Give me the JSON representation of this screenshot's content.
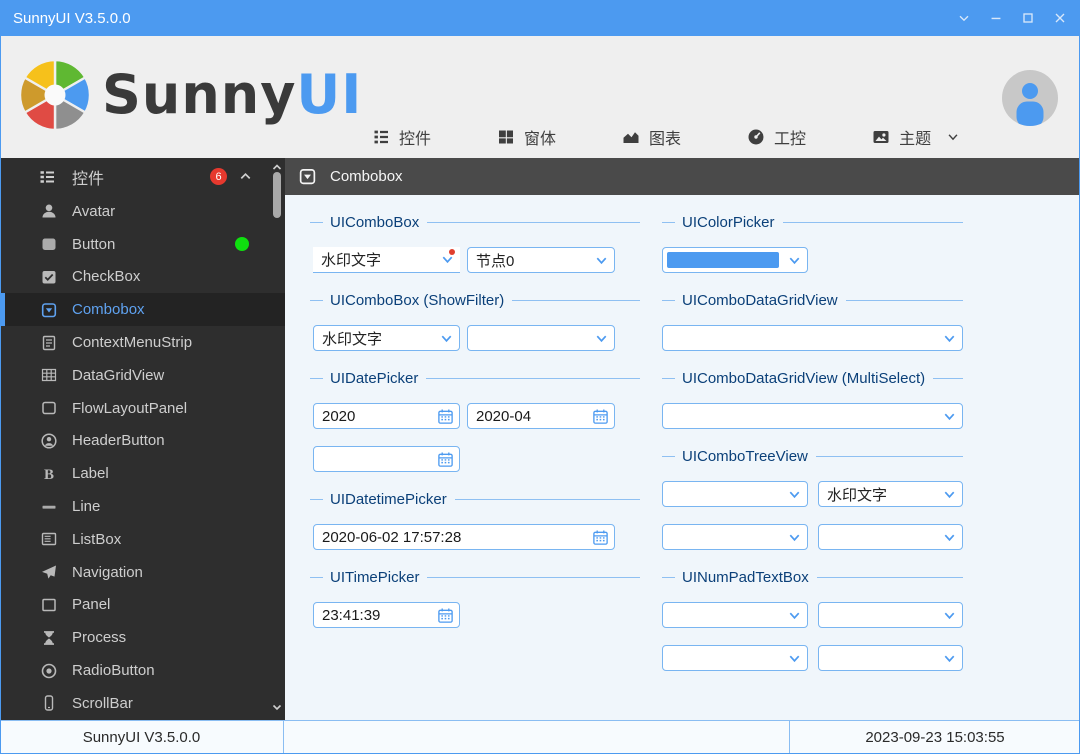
{
  "window": {
    "title": "SunnyUI V3.5.0.0",
    "controls": [
      "chevron-down-icon",
      "minimize-icon",
      "maximize-icon",
      "close-icon"
    ]
  },
  "header": {
    "brand_sunny": "Sunny",
    "brand_ui": "UI",
    "logo_icon": "color-wheel-icon",
    "avatar_icon": "user-avatar-icon",
    "nav": [
      {
        "label": "控件",
        "icon": "list-icon"
      },
      {
        "label": "窗体",
        "icon": "windows-icon"
      },
      {
        "label": "图表",
        "icon": "chart-icon"
      },
      {
        "label": "工控",
        "icon": "gauge-icon"
      },
      {
        "label": "主题",
        "icon": "image-icon",
        "has_dropdown": true
      }
    ]
  },
  "sidebar": {
    "header": {
      "label": "控件",
      "badge": "6",
      "icon": "list-icon",
      "collapse_icon": "chevron-up-icon"
    },
    "items": [
      {
        "label": "Avatar",
        "icon": "person-icon"
      },
      {
        "label": "Button",
        "icon": "button-icon",
        "status_dot": "green"
      },
      {
        "label": "CheckBox",
        "icon": "checkbox-icon"
      },
      {
        "label": "Combobox",
        "icon": "combobox-icon",
        "selected": true
      },
      {
        "label": "ContextMenuStrip",
        "icon": "menustrip-icon"
      },
      {
        "label": "DataGridView",
        "icon": "grid-icon"
      },
      {
        "label": "FlowLayoutPanel",
        "icon": "flow-panel-icon"
      },
      {
        "label": "HeaderButton",
        "icon": "header-button-icon"
      },
      {
        "label": "Label",
        "icon": "bold-b-icon"
      },
      {
        "label": "Line",
        "icon": "line-icon"
      },
      {
        "label": "ListBox",
        "icon": "listbox-icon"
      },
      {
        "label": "Navigation",
        "icon": "paper-plane-icon"
      },
      {
        "label": "Panel",
        "icon": "panel-icon"
      },
      {
        "label": "Process",
        "icon": "hourglass-icon"
      },
      {
        "label": "RadioButton",
        "icon": "radio-icon"
      },
      {
        "label": "ScrollBar",
        "icon": "scrollbar-icon"
      }
    ]
  },
  "main": {
    "title": "Combobox",
    "title_icon": "combobox-icon",
    "left": {
      "combobox": {
        "title": "UIComboBox",
        "watermark": "水印文字",
        "value": "节点0"
      },
      "showfilter": {
        "title": "UIComboBox (ShowFilter)",
        "watermark": "水印文字"
      },
      "datepicker": {
        "title": "UIDatePicker",
        "year": "2020",
        "month": "2020-04",
        "empty": ""
      },
      "datetimepicker": {
        "title": "UIDatetimePicker",
        "value": "2020-06-02 17:57:28"
      },
      "timepicker": {
        "title": "UITimePicker",
        "value": "23:41:39"
      }
    },
    "right": {
      "colorpicker": {
        "title": "UIColorPicker",
        "color": "#4C9AF0"
      },
      "datagrid": {
        "title": "UIComboDataGridView"
      },
      "datagrid_multi": {
        "title": "UIComboDataGridView (MultiSelect)"
      },
      "treeview": {
        "title": "UIComboTreeView",
        "watermark": "水印文字"
      },
      "numpad": {
        "title": "UINumPadTextBox"
      }
    }
  },
  "statusbar": {
    "left": "SunnyUI V3.5.0.0",
    "right": "2023-09-23 15:03:55"
  },
  "colors": {
    "accent_blue": "#4C9AF0",
    "titlebar_bg": "#4C9AF0",
    "header_bg": "#EFEFEF",
    "sidebar_bg": "#2E2E2E",
    "sidebar_selected_text": "#5FA2F0",
    "main_titlebar_bg": "#4A4A4A",
    "content_bg": "#F0F6FB",
    "group_title_text": "#0B4079",
    "control_border": "#79B5F1",
    "badge_red": "#E6392E",
    "notify_dot_red": "#E03E2D",
    "status_dot_green": "#0FE00F",
    "logo_wheel": [
      "#F6C11B",
      "#5FB832",
      "#4C9AF0",
      "#8F8F8F",
      "#E04B44",
      "#CE9A2C"
    ]
  }
}
